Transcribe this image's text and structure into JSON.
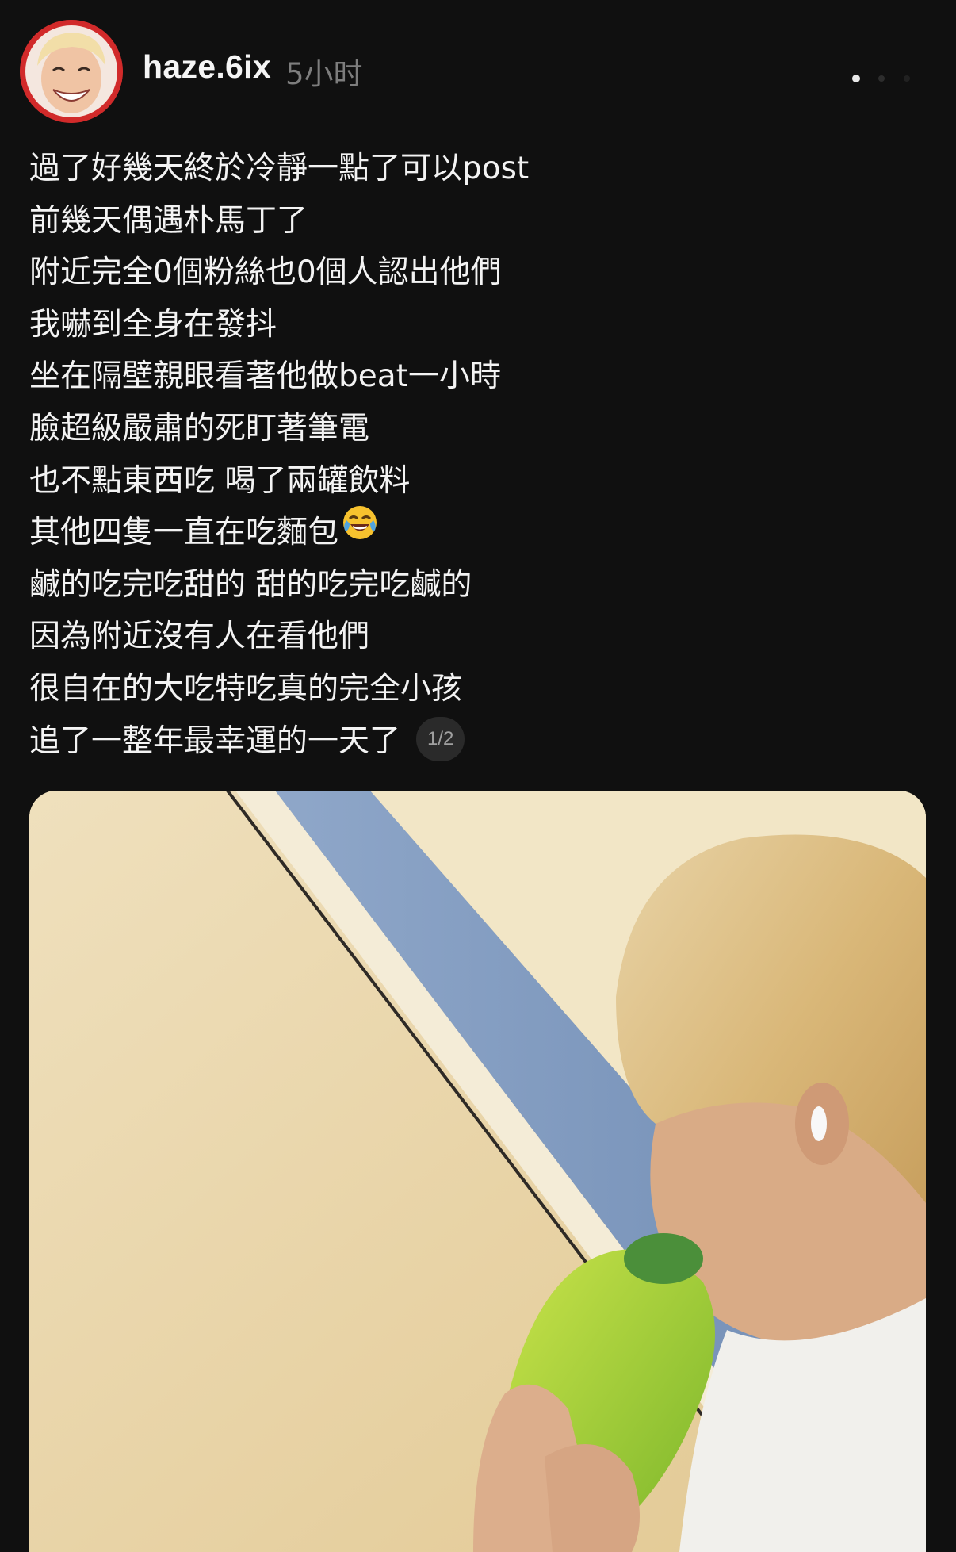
{
  "post": {
    "username": "haze.6ix",
    "timestamp": "5小时",
    "lines": [
      "過了好幾天終於冷靜一點了可以post",
      "前幾天偶遇朴馬丁了",
      "附近完全0個粉絲也0個人認出他們",
      "我嚇到全身在發抖",
      "坐在隔壁親眼看著他做beat一小時",
      "臉超級嚴肅的死盯著筆電",
      "也不點東西吃 喝了兩罐飲料",
      "其他四隻一直在吃麵包",
      "鹹的吃完吃甜的 甜的吃完吃鹹的",
      "因為附近沒有人在看他們",
      "很自在的大吃特吃真的完全小孩",
      "追了一整年最幸運的一天了"
    ],
    "emoji_name": "face-with-tears-of-joy-icon",
    "media_counter": "1/2"
  },
  "icons": {
    "avatar": "avatar",
    "more": "more-options-icon"
  },
  "colors": {
    "background": "#101010",
    "text": "#f3f3f3",
    "muted": "#7d7d7d",
    "badge_bg": "#2a2a2a",
    "avatar_ring": "#c9302c"
  }
}
